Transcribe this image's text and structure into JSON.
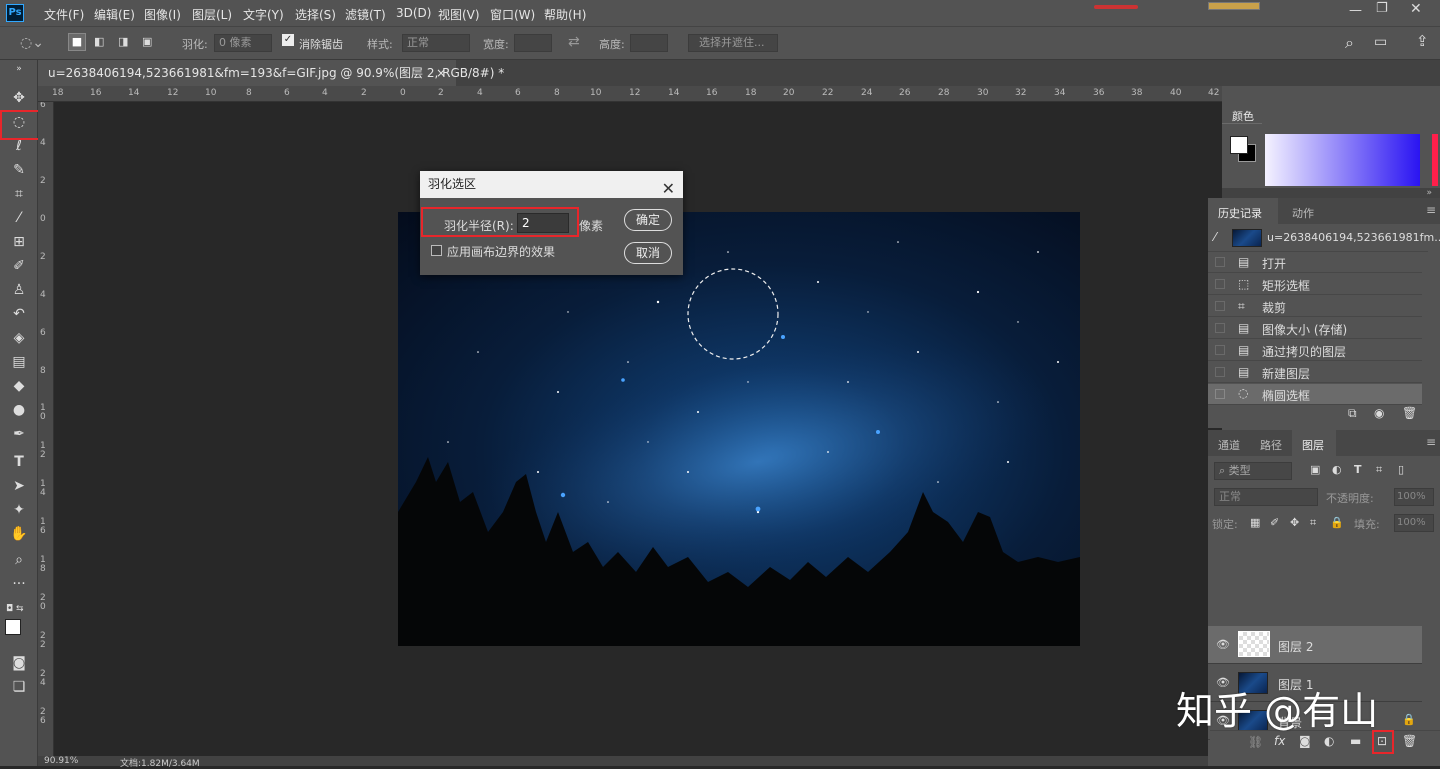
{
  "app": {
    "logo": "Ps"
  },
  "menus": [
    "文件(F)",
    "编辑(E)",
    "图像(I)",
    "图层(L)",
    "文字(Y)",
    "选择(S)",
    "滤镜(T)",
    "3D(D)",
    "视图(V)",
    "窗口(W)",
    "帮助(H)"
  ],
  "options": {
    "feather_label": "羽化:",
    "feather_value": "0 像素",
    "antialias_label": "消除锯齿",
    "style_label": "样式:",
    "style_value": "正常",
    "width_label": "宽度:",
    "height_label": "高度:",
    "select_mask": "选择并遮住..."
  },
  "document": {
    "tab_title": "u=2638406194,523661981&fm=193&f=GIF.jpg @ 90.9%(图层 2, RGB/8#) *",
    "close": "×"
  },
  "ruler": {
    "top": [
      "18",
      "16",
      "14",
      "12",
      "10",
      "8",
      "6",
      "4",
      "2",
      "0",
      "2",
      "4",
      "6",
      "8",
      "10",
      "12",
      "14",
      "16",
      "18",
      "20",
      "22",
      "24",
      "26",
      "28",
      "30",
      "32",
      "34",
      "36",
      "38",
      "40",
      "42"
    ],
    "left": [
      "6",
      "4",
      "2",
      "0",
      "2",
      "4",
      "6",
      "8",
      "1\n0",
      "1\n2",
      "1\n4",
      "1\n6",
      "1\n8",
      "2\n0",
      "2\n2",
      "2\n4",
      "2\n6"
    ]
  },
  "status": {
    "zoom": "90.91%",
    "doc": "文档:1.82M/3.64M"
  },
  "dialog": {
    "title": "羽化选区",
    "radius_label": "羽化半径(R):",
    "radius_value": "2",
    "unit": "像素",
    "checkbox_label": "应用画布边界的效果",
    "ok": "确定",
    "cancel": "取消"
  },
  "color_panel": {
    "tab": "颜色"
  },
  "history_panel": {
    "tabs": [
      "历史记录",
      "动作"
    ],
    "snapshot": "u=2638406194,523661981fm...",
    "items": [
      "打开",
      "矩形选框",
      "裁剪",
      "图像大小 (存储)",
      "通过拷贝的图层",
      "新建图层",
      "椭圆选框"
    ]
  },
  "layers_panel": {
    "tabs": [
      "通道",
      "路径",
      "图层"
    ],
    "filter": "类型",
    "blend_mode": "正常",
    "opacity_label": "不透明度:",
    "opacity_value": "100%",
    "lock_label": "锁定:",
    "fill_label": "填充:",
    "fill_value": "100%",
    "layers": [
      "图层 2",
      "图层 1",
      "背景"
    ]
  },
  "watermark": "知乎 @有山",
  "colors": {
    "highlight": "#e8262b",
    "ui_dark": "#535353",
    "canvas": "#282828"
  }
}
